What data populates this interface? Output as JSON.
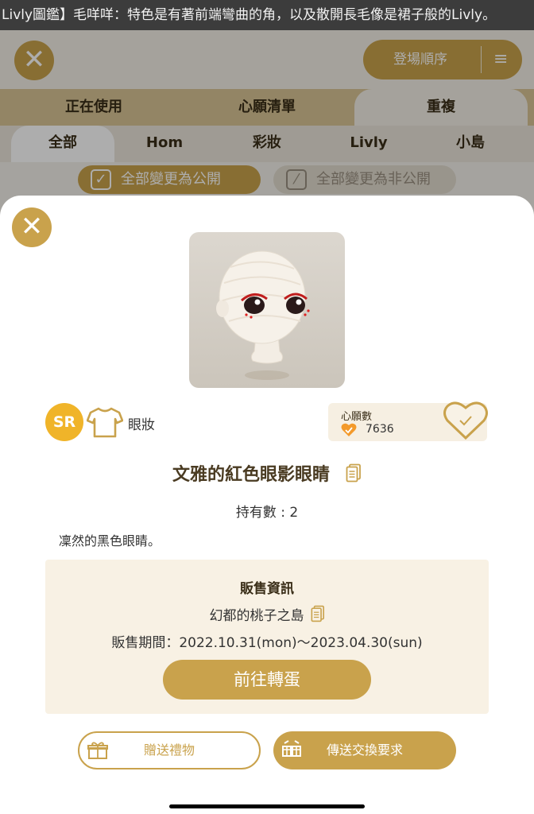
{
  "banner": {
    "text": "Livly圖鑑】毛咩咩：特色是有著前端彎曲的角，以及散開長毛像是裙子般的Livly。"
  },
  "background": {
    "close_glyph": "✕",
    "sort_label": "登場順序",
    "sort_icon_glyph": "≡",
    "tabs_primary": [
      "正在使用",
      "心願清單",
      "重複"
    ],
    "tabs_secondary": [
      "全部",
      "Hom",
      "彩妝",
      "Livly",
      "小島"
    ],
    "public_all_label": "全部變更為公開",
    "private_all_label": "全部變更為非公開"
  },
  "modal": {
    "close_glyph": "✕",
    "rarity": "SR",
    "category": "眼妝",
    "wish": {
      "title": "心願數",
      "count": "7636"
    },
    "item_name": "文雅的紅色眼影眼睛",
    "owned": "持有數 : 2",
    "description": "凜然的黑色眼睛。",
    "sale": {
      "title": "販售資訊",
      "place": "幻都的桃子之島",
      "period": "販售期間：2022.10.31(mon)～2023.04.30(sun)",
      "button": "前往轉蛋"
    },
    "gift_button": "贈送禮物",
    "trade_button": "傳送交換要求"
  },
  "colors": {
    "accent": "#c9a24c",
    "rarity": "#f0b429",
    "heart": "#f39a2b"
  }
}
